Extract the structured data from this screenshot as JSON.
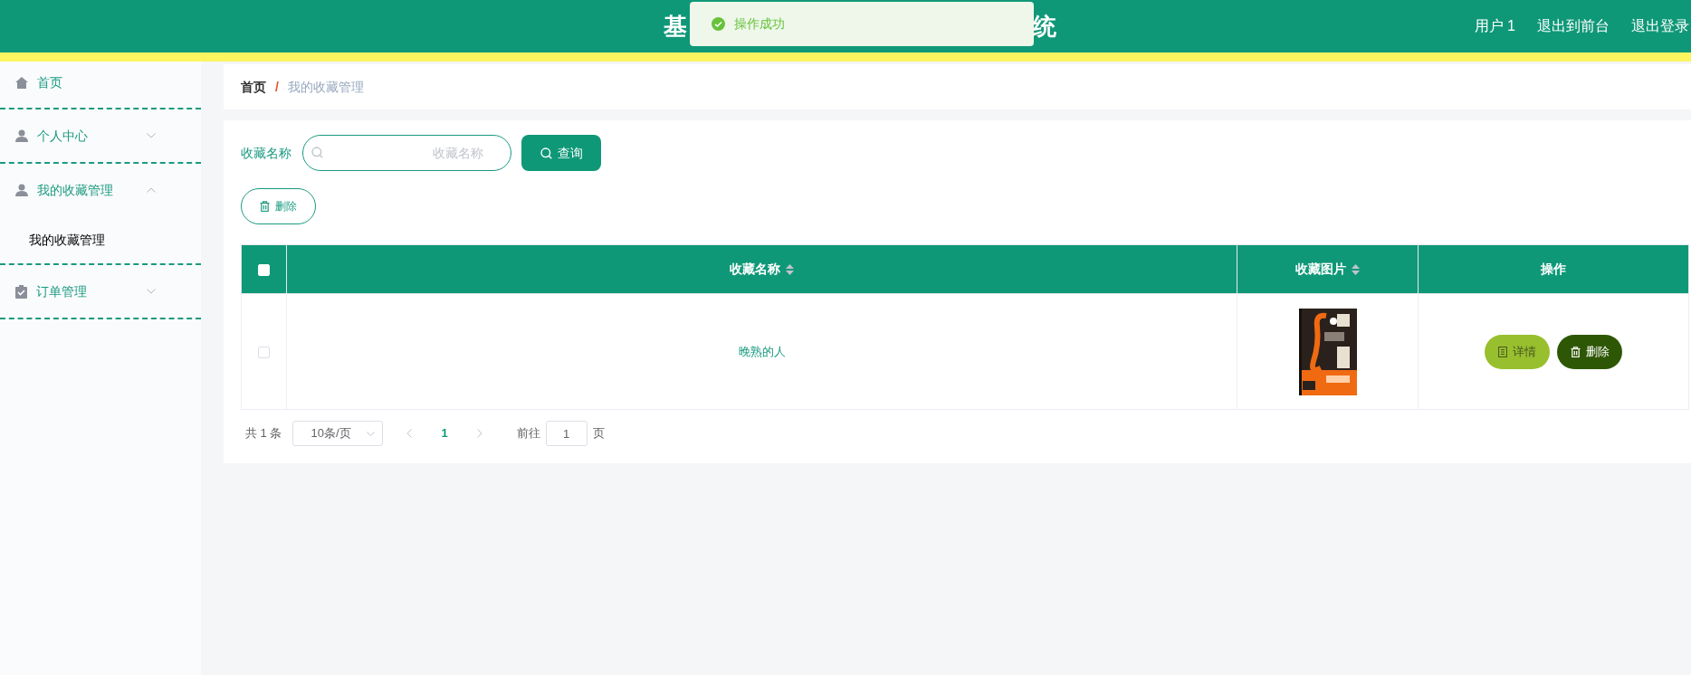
{
  "header": {
    "title_parts": [
      "基",
      "统"
    ],
    "links": [
      "用户 1",
      "退出到前台",
      "退出登录"
    ]
  },
  "toast": {
    "message": "操作成功"
  },
  "sidebar": {
    "items": [
      {
        "label": "首页"
      },
      {
        "label": "个人中心",
        "expanded": false
      },
      {
        "label": "我的收藏管理",
        "expanded": true,
        "children": [
          {
            "label": "我的收藏管理"
          }
        ]
      },
      {
        "label": "订单管理",
        "expanded": false
      }
    ]
  },
  "breadcrumb": {
    "home": "首页",
    "separator": "/",
    "current": "我的收藏管理"
  },
  "search": {
    "label": "收藏名称",
    "placeholder": "收藏名称",
    "button": "查询"
  },
  "toolbar": {
    "delete_button": "删除"
  },
  "table": {
    "all_checked": false,
    "columns": [
      {
        "label": "收藏名称",
        "sortable": true
      },
      {
        "label": "收藏图片",
        "sortable": true
      },
      {
        "label": "操作",
        "sortable": false
      }
    ],
    "rows": [
      {
        "checked": false,
        "name": "晚熟的人",
        "image": {
          "kind": "picture"
        },
        "actions": [
          {
            "kind": "detail",
            "label": "详情"
          },
          {
            "kind": "delete",
            "label": "删除"
          }
        ]
      }
    ]
  },
  "pagination": {
    "total": "共 1 条",
    "page_size": "10条/页",
    "pages": [
      {
        "label": "1",
        "selected": true
      }
    ],
    "goto_label": "前往",
    "goto_value": "1",
    "goto_suffix": "页"
  }
}
